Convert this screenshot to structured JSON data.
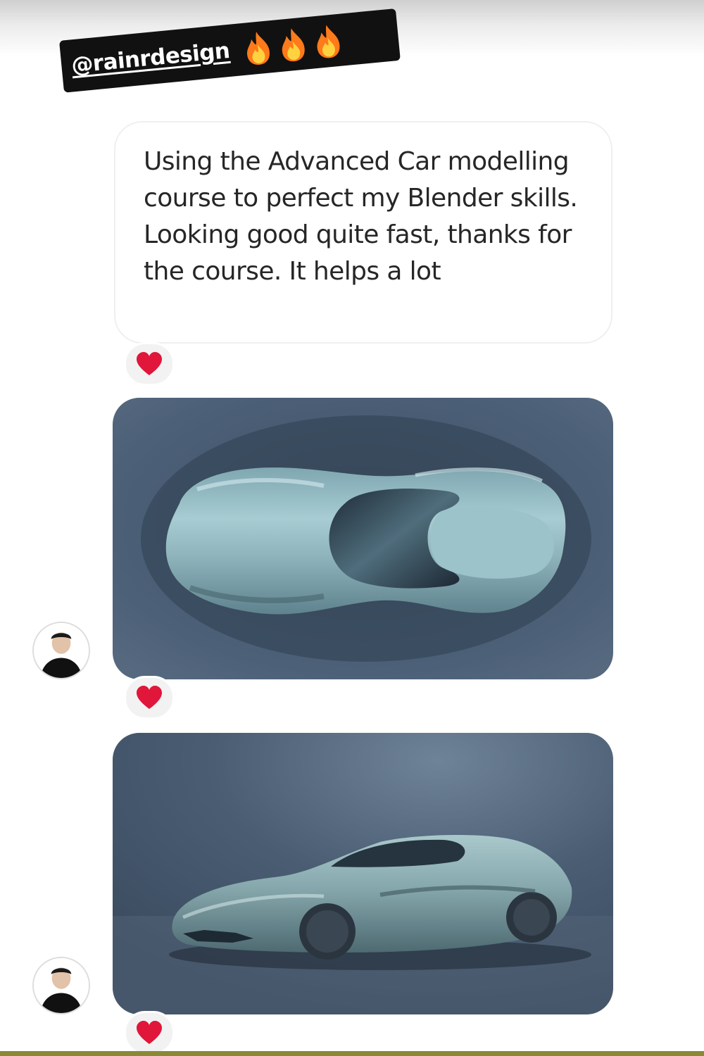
{
  "story": {
    "mention": "@rainrdesign",
    "mention_emoji": [
      "fire-icon",
      "fire-icon",
      "fire-icon"
    ]
  },
  "conversation": {
    "message_text": "Using the Advanced Car modelling course to perfect my Blender skills. Looking good quite fast, thanks for the course. It helps a lot",
    "reactions": [
      "heart-icon",
      "heart-icon",
      "heart-icon"
    ],
    "images": [
      {
        "depicts": "top-view-car-render"
      },
      {
        "depicts": "side-view-car-render"
      }
    ]
  },
  "colors": {
    "reaction_heart": "#e0163a",
    "sticker_background": "#111111",
    "render_background": "#4a5d73",
    "car_body": "#8fb4bc"
  }
}
